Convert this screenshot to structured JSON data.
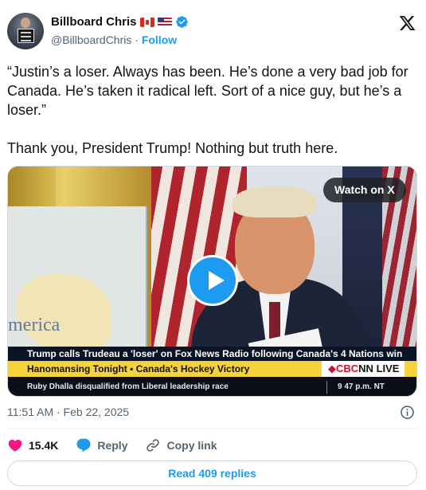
{
  "author": {
    "name": "Billboard Chris",
    "handle": "@BillboardChris",
    "separator": "·",
    "follow_label": "Follow"
  },
  "tweet": {
    "text": "“Justin’s a loser. Always has been. He’s done a very bad job for Canada. He’s taken it radical left. Sort of a nice guy, but he’s a loser.”\n\nThank you, President Trump! Nothing but truth here."
  },
  "media": {
    "watch_label": "Watch on X",
    "background_text": "merica",
    "chyron_headline": "Trump calls Trudeau a 'loser' on Fox News Radio following Canada's 4 Nations win",
    "chyron_topic": "Hanomansing Tonight  ▪  Canada's Hockey Victory",
    "chyron_logo_prefix": "◆CBC",
    "chyron_logo_mid": "NN",
    "chyron_logo_suffix": " LIVE",
    "chyron_ticker": "Ruby Dhalla disqualified from Liberal leadership race",
    "chyron_time": "9 47 p.m. NT"
  },
  "footer": {
    "timestamp": "11:51 AM · Feb 22, 2025",
    "likes": "15.4K",
    "reply_label": "Reply",
    "copy_link_label": "Copy link",
    "read_replies_label": "Read 409 replies"
  },
  "icons": {
    "verified": "verified-badge-icon",
    "x_logo": "x-logo-icon",
    "heart": "heart-icon",
    "reply": "reply-bubble-icon",
    "link": "link-icon",
    "info": "info-icon"
  },
  "colors": {
    "accent": "#1d9bf0",
    "like": "#f91880",
    "muted": "#536471"
  }
}
